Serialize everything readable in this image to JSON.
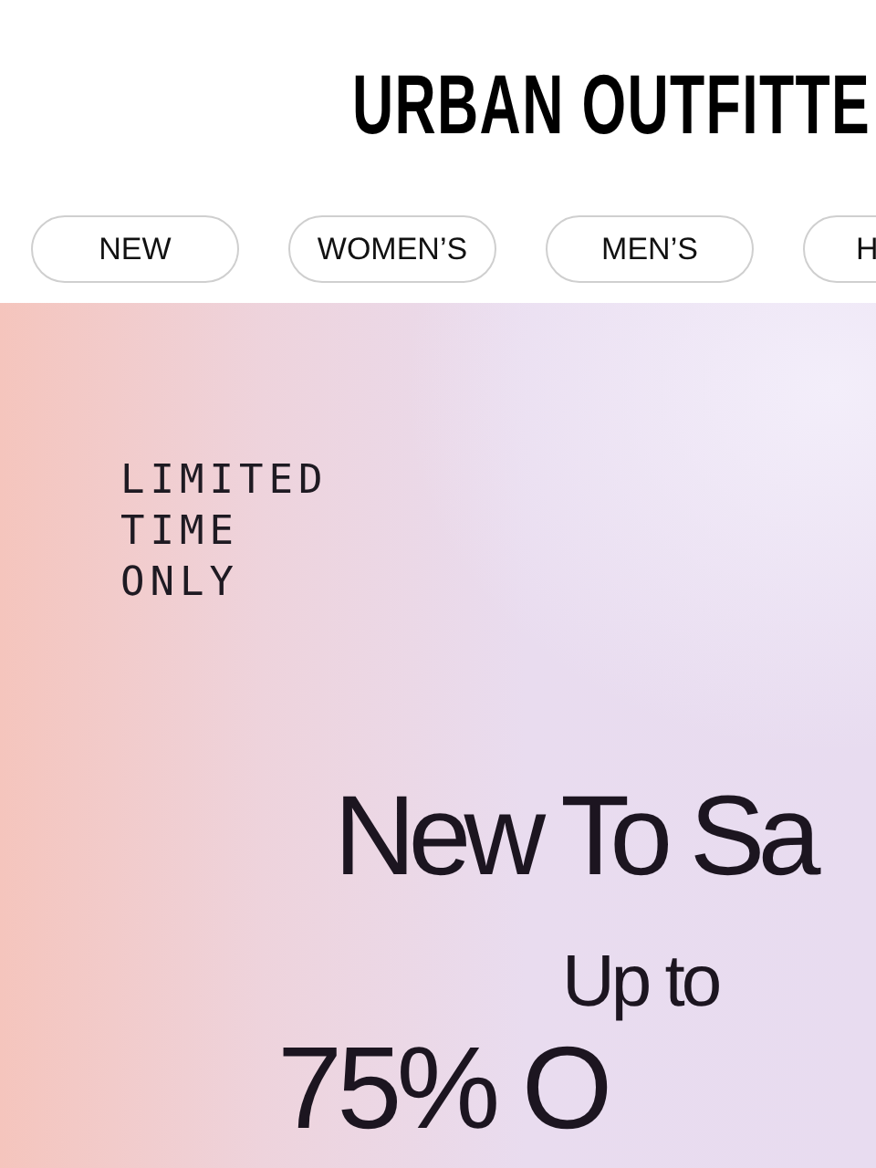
{
  "header": {
    "logo": "URBAN OUTFITTE"
  },
  "categories": [
    {
      "label": "NEW"
    },
    {
      "label": "WOMEN’S"
    },
    {
      "label": "MEN’S"
    },
    {
      "label": "H"
    }
  ],
  "hero": {
    "eyebrow": [
      "LIMITED",
      "TIME",
      "ONLY"
    ],
    "headline": "New To Sa",
    "subhead": "Up to",
    "offer": "75% O"
  }
}
